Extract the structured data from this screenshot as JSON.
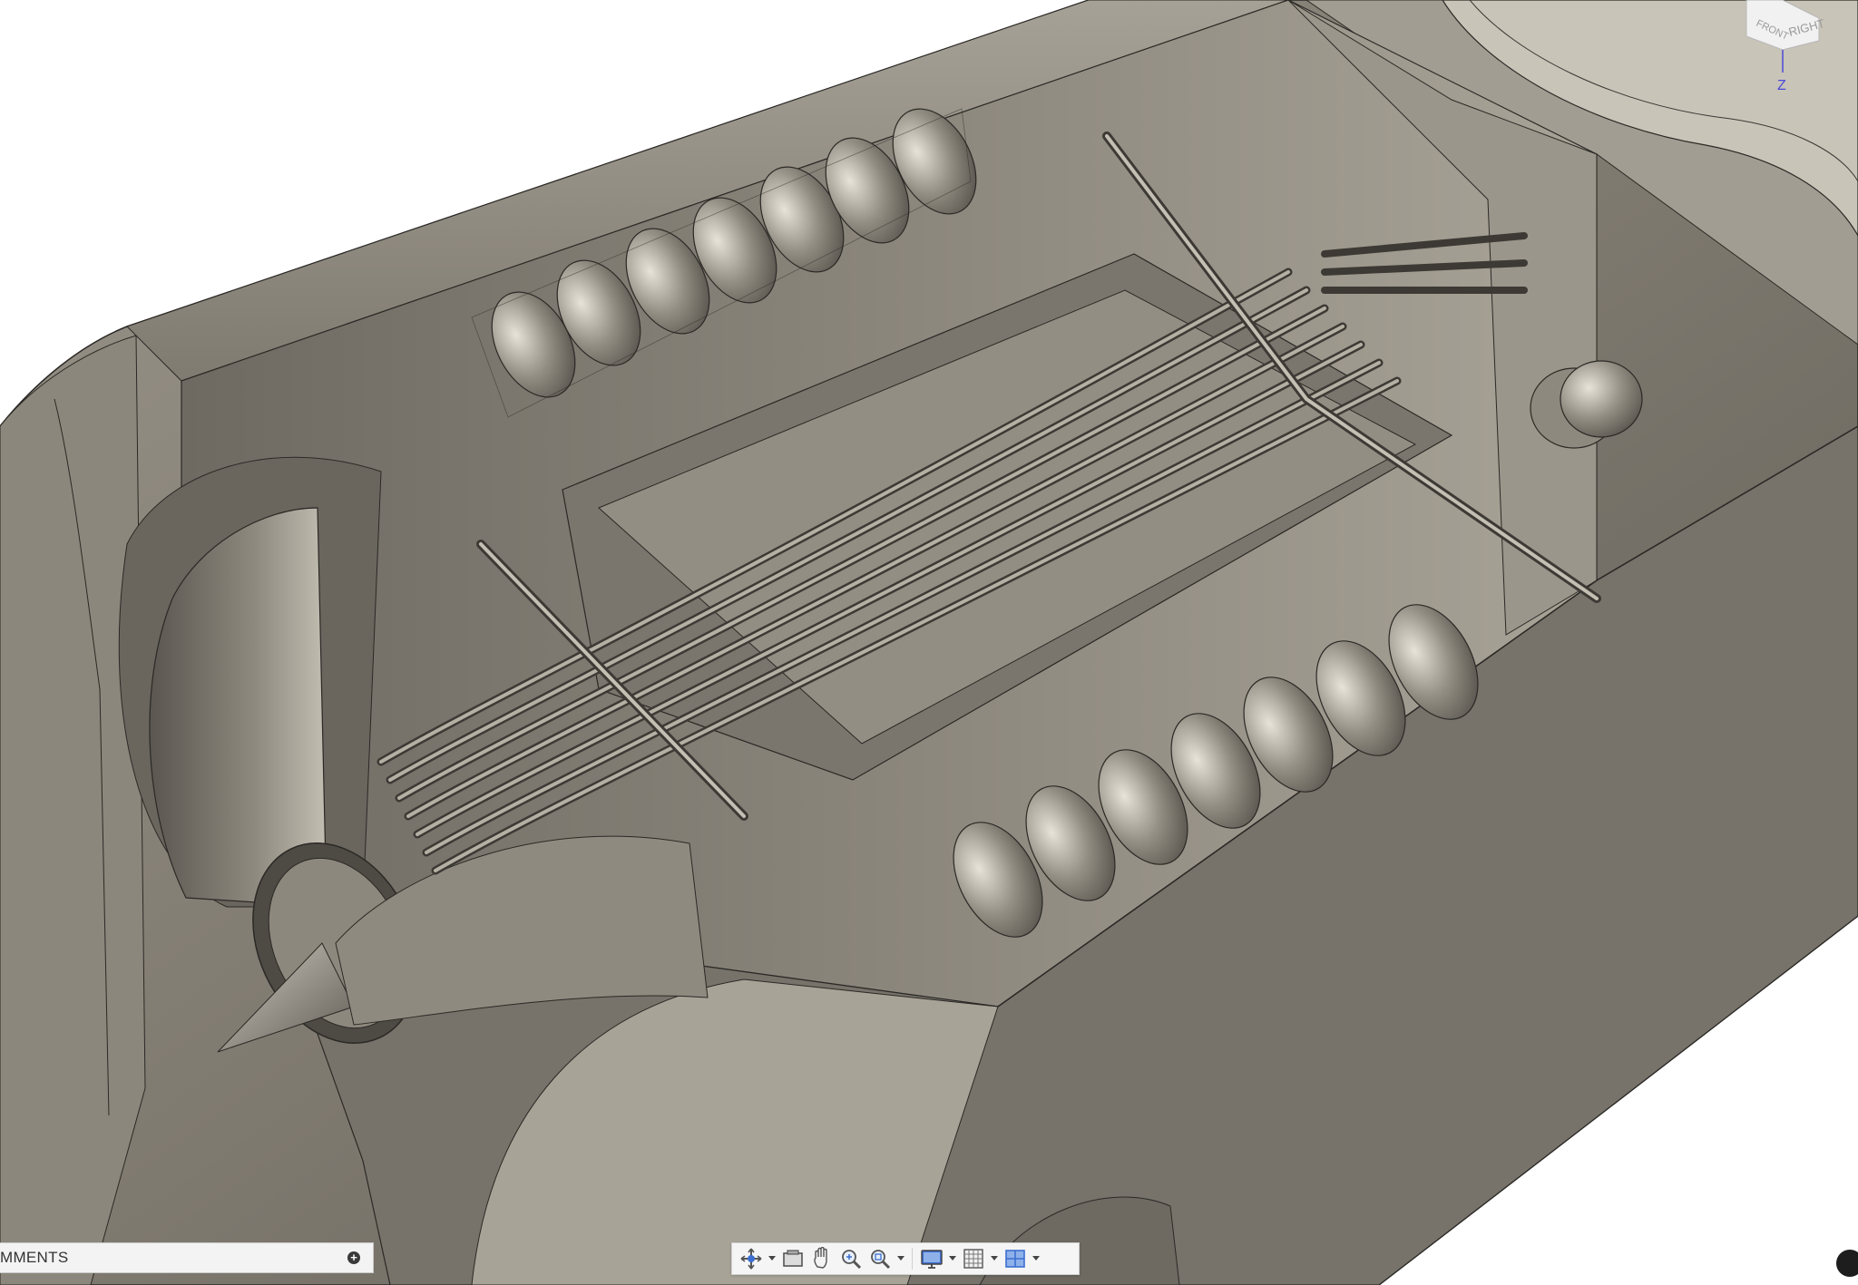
{
  "viewcube": {
    "face_front": "FRONT",
    "face_right": "RIGHT",
    "axis_z": "Z"
  },
  "comments": {
    "label": "MMENTS",
    "add_symbol": "+"
  },
  "toolbar": {
    "items": [
      {
        "name": "orbit-icon",
        "has_menu": true
      },
      {
        "name": "look-at-icon",
        "has_menu": false
      },
      {
        "name": "pan-icon",
        "has_menu": false
      },
      {
        "name": "zoom-icon",
        "has_menu": false
      },
      {
        "name": "zoom-window-icon",
        "has_menu": true
      },
      {
        "name": "display-settings-icon",
        "has_menu": true
      },
      {
        "name": "grid-settings-icon",
        "has_menu": true
      },
      {
        "name": "viewports-icon",
        "has_menu": true
      }
    ]
  },
  "colors": {
    "metal_dark": "#5f5b54",
    "metal_mid": "#8a857b",
    "metal_light": "#bdb8ad",
    "accent_blue": "#3d6fd1",
    "axis_z": "#4a4ad8"
  }
}
